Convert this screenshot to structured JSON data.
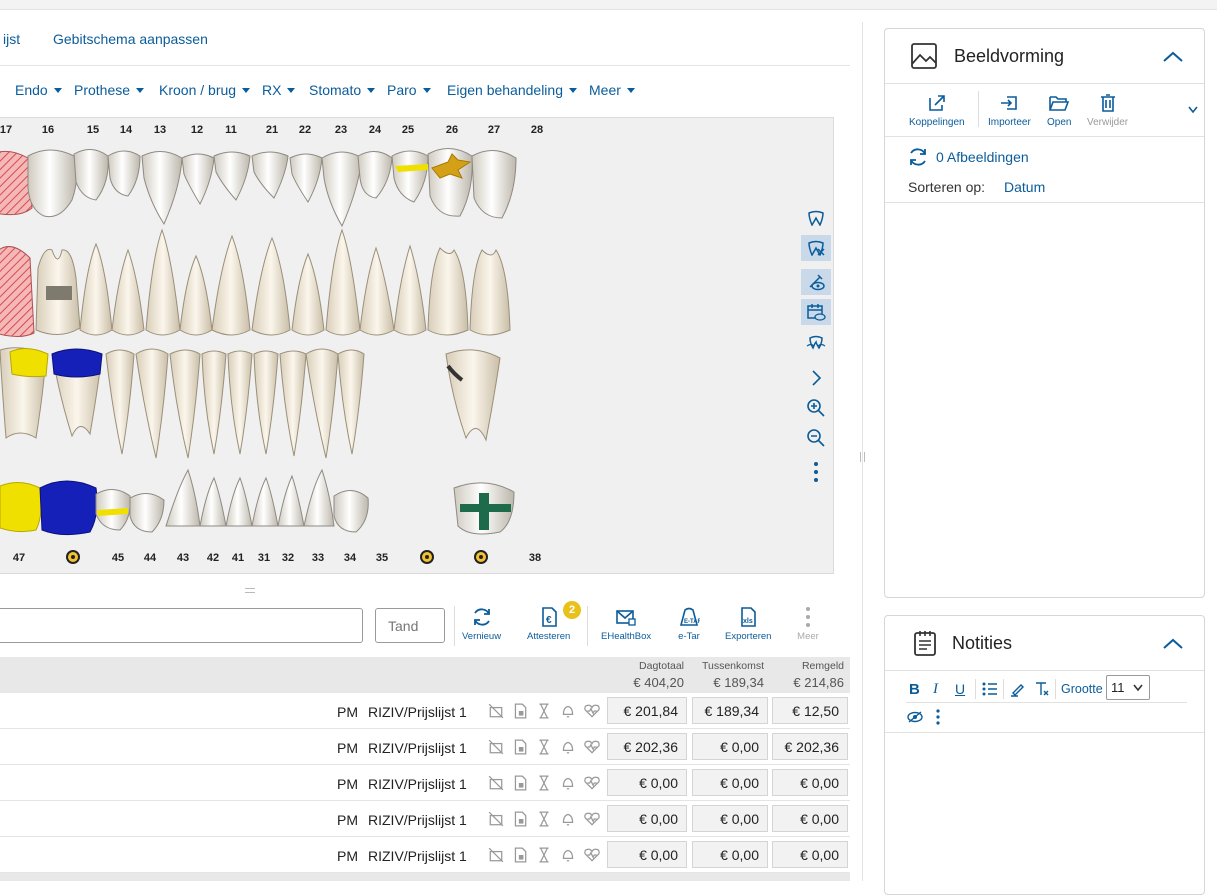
{
  "topnav": {
    "link1": "ijst",
    "link2": "Gebitschema aanpassen"
  },
  "menu": [
    "Endo",
    "Prothese",
    "Kroon / brug",
    "RX",
    "Stomato",
    "Paro",
    "Eigen behandeling",
    "Meer"
  ],
  "chart": {
    "upper_numbers": [
      "17",
      "16",
      "15",
      "14",
      "13",
      "12",
      "11",
      "21",
      "22",
      "23",
      "24",
      "25",
      "26",
      "27",
      "28"
    ],
    "lower_numbers": [
      "47",
      "45",
      "44",
      "43",
      "42",
      "41",
      "31",
      "32",
      "33",
      "34",
      "35",
      "38"
    ],
    "xray_markers": 3
  },
  "side_tools": [
    "tooth-icon",
    "tooth-x-icon",
    "anesthesia-eye-icon",
    "calendar-eye-icon",
    "tooth-roots-icon",
    "chevron-right-icon",
    "zoom-in-icon",
    "zoom-out-icon",
    "more-vertical-icon"
  ],
  "toolbar": {
    "tand_placeholder": "Tand",
    "vernieuw": "Vernieuw",
    "attesteren": "Attesteren",
    "attesteren_badge": "2",
    "ehealthbox": "EHealthBox",
    "etar": "e-Tar",
    "exporteren": "Exporteren",
    "meer": "Meer"
  },
  "table": {
    "headers": {
      "dagtotaal": "Dagtotaal",
      "tussenkomst": "Tussenkomst",
      "remgeld": "Remgeld"
    },
    "totals": {
      "dagtotaal": "€ 404,20",
      "tussenkomst": "€ 189,34",
      "remgeld": "€ 214,86"
    },
    "rows": [
      {
        "type": "PM",
        "list": "RIZIV/Prijslijst 1",
        "dagtotaal": "€ 201,84",
        "tussenkomst": "€ 189,34",
        "remgeld": "€ 12,50"
      },
      {
        "type": "PM",
        "list": "RIZIV/Prijslijst 1",
        "dagtotaal": "€ 202,36",
        "tussenkomst": "€ 0,00",
        "remgeld": "€ 202,36"
      },
      {
        "type": "PM",
        "list": "RIZIV/Prijslijst 1",
        "dagtotaal": "€ 0,00",
        "tussenkomst": "€ 0,00",
        "remgeld": "€ 0,00"
      },
      {
        "type": "PM",
        "list": "RIZIV/Prijslijst 1",
        "dagtotaal": "€ 0,00",
        "tussenkomst": "€ 0,00",
        "remgeld": "€ 0,00"
      },
      {
        "type": "PM",
        "list": "RIZIV/Prijslijst 1",
        "dagtotaal": "€ 0,00",
        "tussenkomst": "€ 0,00",
        "remgeld": "€ 0,00"
      }
    ],
    "footer_headers": {
      "dagtotaal": "Dagtotaal",
      "tussenkomst": "Tussenkomst",
      "remgeld": "Remgeld"
    }
  },
  "beeldvorming": {
    "title": "Beeldvorming",
    "buttons": {
      "koppelingen": "Koppelingen",
      "importeer": "Importeer",
      "open": "Open",
      "verwijder": "Verwijder"
    },
    "count": "0 Afbeeldingen",
    "sort_label": "Sorteren op:",
    "sort_value": "Datum"
  },
  "notities": {
    "title": "Notities",
    "grootte_label": "Grootte",
    "grootte_value": "11"
  },
  "colors": {
    "accent": "#0b5c9a",
    "filling_yellow": "#f0e000",
    "crown_blue": "#1520b8",
    "crown_green": "#1d6b4a",
    "gold": "#d4a017"
  }
}
